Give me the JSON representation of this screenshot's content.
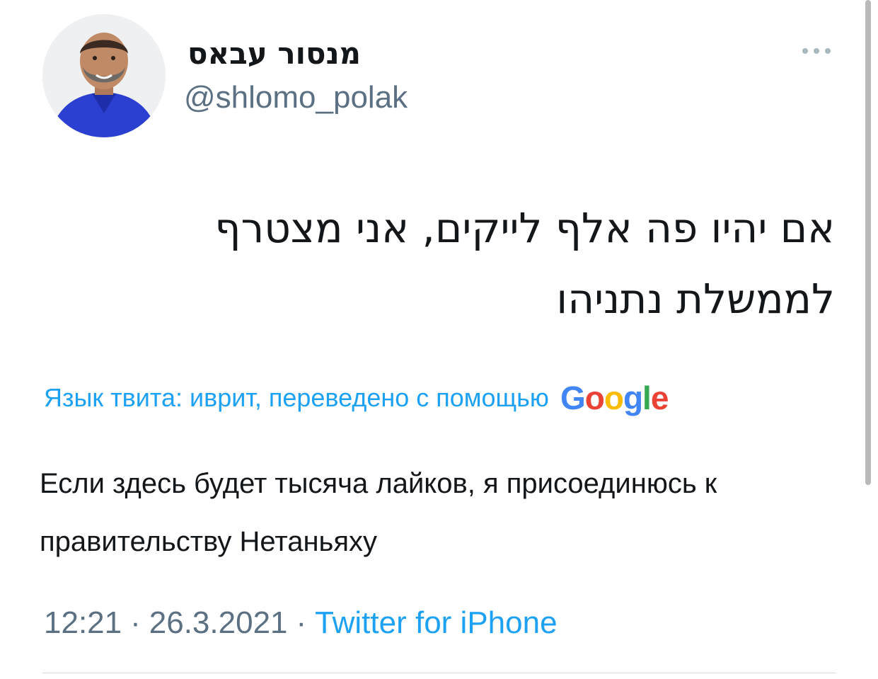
{
  "author": {
    "display_name": "מנסור עבאס",
    "handle": "@shlomo_polak",
    "avatar_icon": "profile-photo"
  },
  "menu": {
    "icon": "more-horizontal-icon"
  },
  "tweet": {
    "text": "אם יהיו פה אלף לייקים, אני מצטרף לממשלת נתניהו"
  },
  "translation": {
    "label": "Язык твита: иврит, переведено с помощью",
    "provider": "Google",
    "text": "Если здесь будет тысяча лайков, я присоединюсь к правительству Нетаньяху"
  },
  "meta": {
    "time": "12:21",
    "separator": "·",
    "date": "26.3.2021",
    "source": "Twitter for iPhone"
  },
  "colors": {
    "link": "#1da1f2",
    "secondary_text": "#5b7083",
    "primary_text": "#14171a"
  }
}
